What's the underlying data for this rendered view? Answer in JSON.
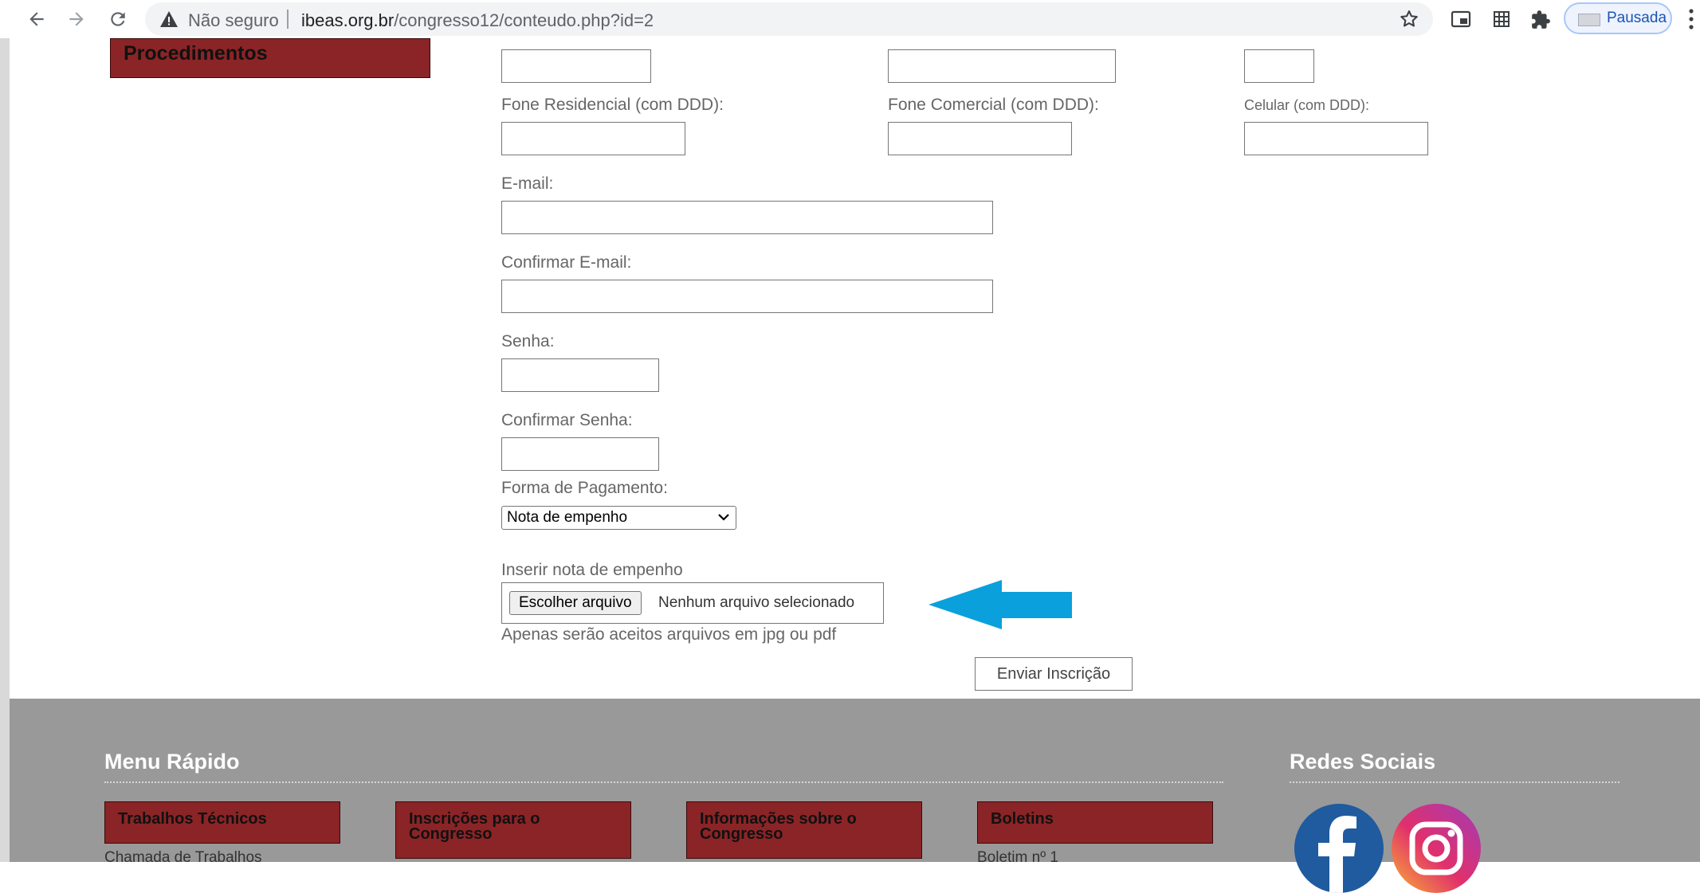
{
  "browser": {
    "security_label": "Não seguro",
    "url_domain": "ibeas.org.br",
    "url_path": "/congresso12/conteudo.php?id=2",
    "profile_label": "Pausada"
  },
  "sidebar": {
    "active_button": "Procedimentos"
  },
  "form": {
    "fone_residencial_label": "Fone Residencial (com DDD):",
    "fone_comercial_label": "Fone Comercial (com DDD):",
    "celular_label": "Celular (com DDD):",
    "email_label": "E-mail:",
    "confirm_email_label": "Confirmar E-mail:",
    "senha_label": "Senha:",
    "confirm_senha_label": "Confirmar Senha:",
    "payment_label": "Forma de Pagamento:",
    "payment_selected": "Nota de empenho",
    "upload_label": "Inserir nota de empenho",
    "file_button": "Escolher arquivo",
    "file_status": "Nenhum arquivo selecionado",
    "upload_note": "Apenas serão aceitos arquivos em jpg ou pdf",
    "submit_label": "Enviar Inscrição"
  },
  "footer": {
    "menu_title": "Menu Rápido",
    "social_title": "Redes Sociais",
    "buttons": [
      {
        "line1": "Trabalhos Técnicos",
        "line2": ""
      },
      {
        "line1": "Inscrições para o",
        "line2": "Congresso"
      },
      {
        "line1": "Informações sobre o",
        "line2": "Congresso"
      },
      {
        "line1": "Boletins",
        "line2": ""
      }
    ],
    "sub_links": [
      "Chamada de Trabalhos",
      "Boletim nº 1"
    ]
  },
  "colors": {
    "accent": "#8b2426",
    "footer_bg": "#999999",
    "arrow": "#0aa0dc"
  }
}
